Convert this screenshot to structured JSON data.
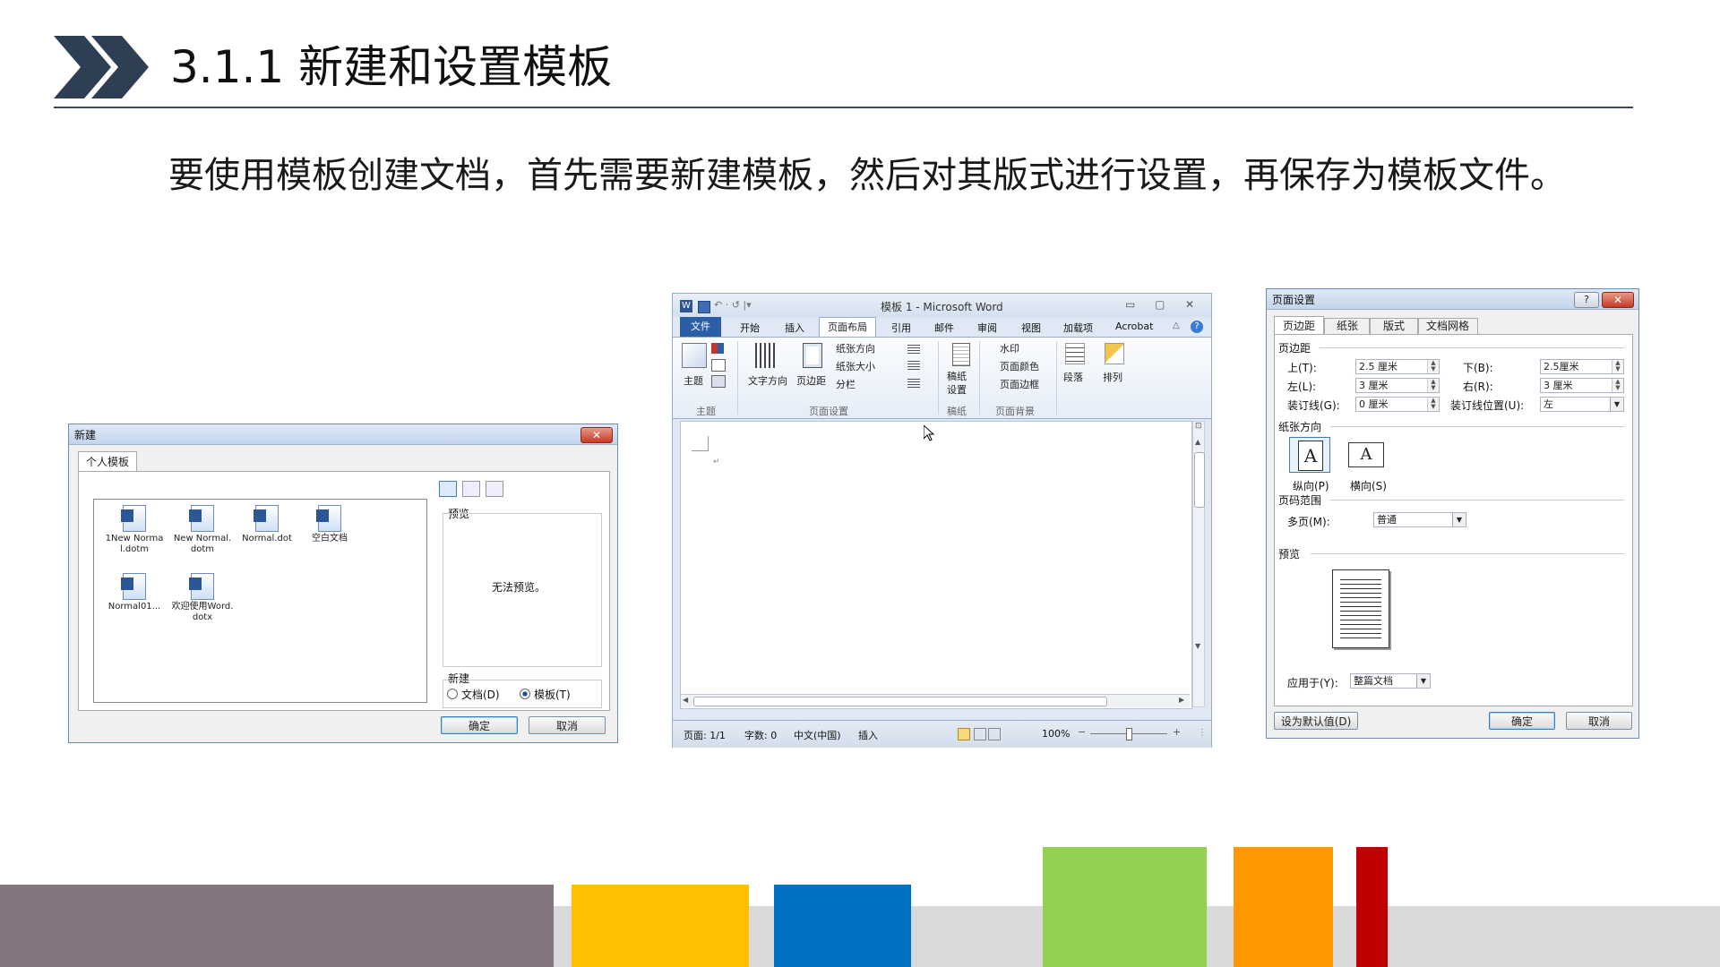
{
  "header": {
    "title": "3.1.1  新建和设置模板",
    "intro": "要使用模板创建文档，首先需要新建模板，然后对其版式进行设置，再保存为模板文件。"
  },
  "colors": {
    "chevron": "#2e3f53",
    "rule": "#3a4a5c",
    "bar_purple": "#85757f",
    "bar_yellow": "#ffc000",
    "bar_blue": "#0070c0",
    "bar_green": "#92d050",
    "bar_orange": "#ff9900",
    "bar_red": "#c00000",
    "bar_gray": "#d9d9d9"
  },
  "new_dialog": {
    "title": "新建",
    "close": "✕",
    "tab": "个人模板",
    "templates": [
      {
        "name": "1New Normal.dotm"
      },
      {
        "name": "New Normal.dotm"
      },
      {
        "name": "Normal.dot"
      },
      {
        "name": "空白文档"
      },
      {
        "name": "Normal01..."
      },
      {
        "name": "欢迎使用Word.dotx"
      }
    ],
    "preview_label": "预览",
    "no_preview": "无法预览。",
    "new_label": "新建",
    "radio_document": "文档(D)",
    "radio_template": "模板(T)",
    "ok": "确定",
    "cancel": "取消"
  },
  "word": {
    "title": "模板 1 - Microsoft Word",
    "tabs": [
      "文件",
      "开始",
      "插入",
      "页面布局",
      "引用",
      "邮件",
      "审阅",
      "视图",
      "加载项",
      "Acrobat"
    ],
    "active_tab": "页面布局",
    "ribbon": {
      "theme_btn": "主题",
      "text_dir": "文字方向",
      "margins": "页边距",
      "orientation": "纸张方向",
      "size": "纸张大小",
      "columns": "分栏",
      "paper_setting": "稿纸\n设置",
      "watermark": "水印",
      "page_color": "页面颜色",
      "page_border": "页面边框",
      "paragraph": "段落",
      "arrange": "排列",
      "groups": [
        "主题",
        "页面设置",
        "稿纸",
        "页面背景"
      ]
    },
    "status": {
      "page": "页面: 1/1",
      "words": "字数: 0",
      "lang": "中文(中国)",
      "insert": "插入",
      "zoom": "100%"
    },
    "glyphs": {
      "window_controls": [
        "▭",
        "▢",
        "✕"
      ],
      "qat": "↶ · ↺ |▾",
      "collapse": "△",
      "help": "?",
      "return_mark": "↵",
      "ruler_toggle": "⊡",
      "scroll_up": "▲",
      "scroll_down": "▼",
      "scroll_left": "◀",
      "scroll_right": "▶",
      "zoom_out": "−",
      "zoom_in": "+",
      "grip": "⋮"
    }
  },
  "page_setup": {
    "title": "页面设置",
    "help": "?",
    "close": "✕",
    "tabs": [
      "页边距",
      "纸张",
      "版式",
      "文档网格"
    ],
    "margins_label": "页边距",
    "top_label": "上(T):",
    "top_value": "2.5 厘米",
    "bottom_label": "下(B):",
    "bottom_value": "2.5厘米",
    "left_label": "左(L):",
    "left_value": "3 厘米",
    "right_label": "右(R):",
    "right_value": "3 厘米",
    "gutter_label": "装订线(G):",
    "gutter_value": "0 厘米",
    "gutter_pos_label": "装订线位置(U):",
    "gutter_pos_value": "左",
    "orientation_label": "纸张方向",
    "portrait": "纵向(P)",
    "landscape": "横向(S)",
    "glyph_letter": "A",
    "pages_label": "页码范围",
    "multi_label": "多页(M):",
    "multi_value": "普通",
    "preview_label": "预览",
    "apply_label": "应用于(Y):",
    "apply_value": "整篇文档",
    "default_btn": "设为默认值(D)",
    "ok": "确定",
    "cancel": "取消"
  }
}
